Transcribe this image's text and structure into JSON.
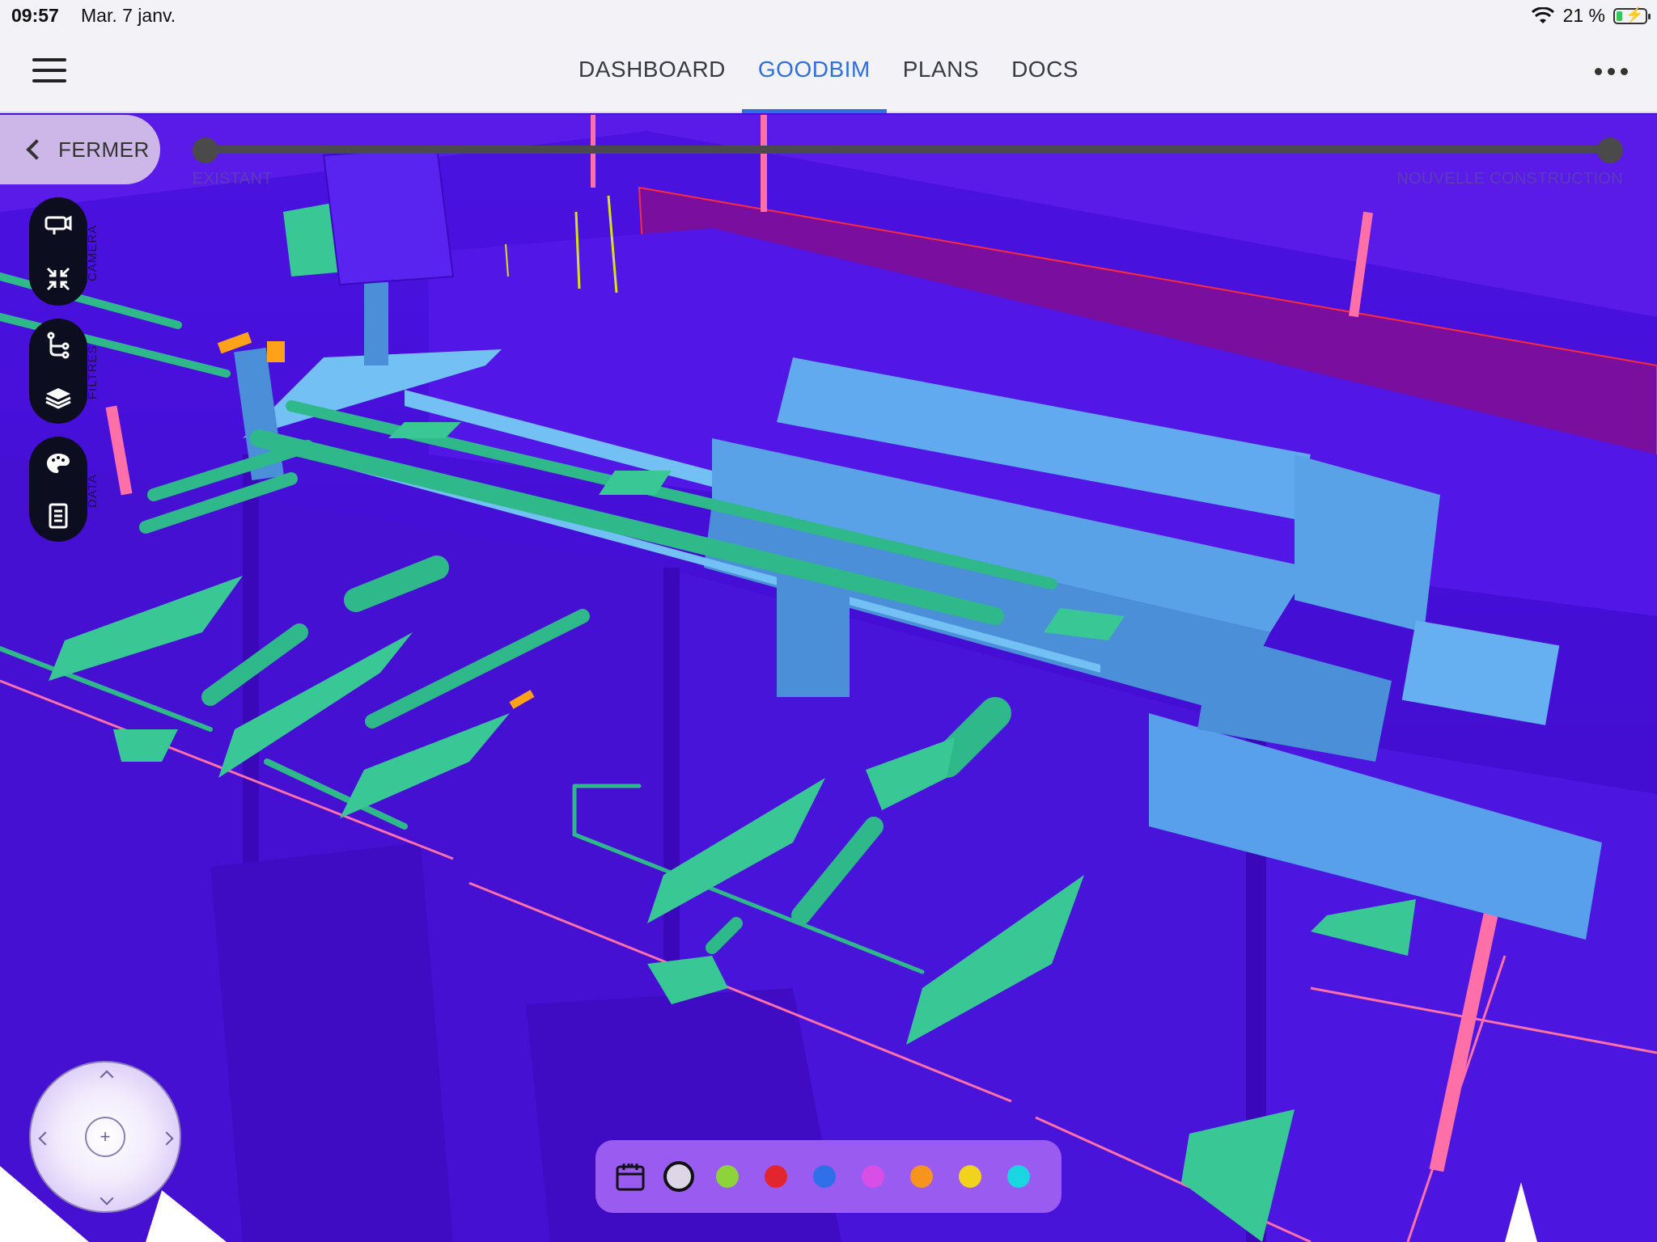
{
  "status_bar": {
    "time": "09:57",
    "date": "Mar. 7 janv.",
    "battery": "21 %",
    "battery_level": 0.21
  },
  "nav": {
    "tabs": [
      {
        "label": "DASHBOARD",
        "active": false
      },
      {
        "label": "GOODBIM",
        "active": true
      },
      {
        "label": "PLANS",
        "active": false
      },
      {
        "label": "DOCS",
        "active": false
      }
    ],
    "menu_icon": "hamburger-icon",
    "more_icon": "more-dots-icon"
  },
  "viewer": {
    "close_label": "FERMER",
    "timeline": {
      "start_label": "EXISTANT",
      "end_label": "NOUVELLE CONSTRUCTION"
    },
    "tool_groups": [
      {
        "tag": "CAMERA",
        "icons": [
          "camera-icon",
          "collapse-arrows-icon"
        ]
      },
      {
        "tag": "FILTRES",
        "icons": [
          "branch-icon",
          "layers-icon"
        ]
      },
      {
        "tag": "DATA",
        "icons": [
          "palette-icon",
          "document-icon"
        ]
      }
    ]
  },
  "colors": {
    "accent": "#2f6fe0",
    "palette": [
      "#dcd6e6",
      "#8cd43a",
      "#e3262e",
      "#2f6fe8",
      "#d84fe6",
      "#f7941d",
      "#f2d31b",
      "#1ad6e0"
    ],
    "selected_index": 0
  }
}
